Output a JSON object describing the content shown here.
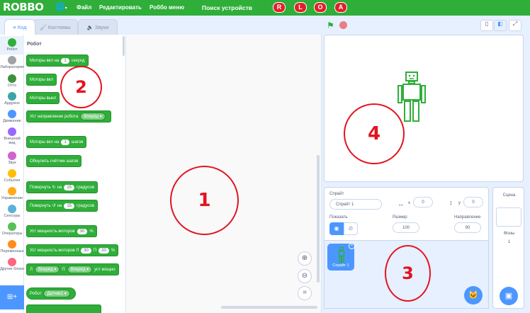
{
  "menubar": {
    "logo": "ROBBO",
    "file": "Файл",
    "edit": "Редактировать",
    "robbo_menu": "Роббо меню",
    "device_search": "Поиск устройств",
    "badges": [
      "R",
      "L",
      "O",
      "A"
    ]
  },
  "tabs": {
    "code": "Код",
    "costumes": "Костюмы",
    "sounds": "Звуки"
  },
  "categories": [
    {
      "label": "Робот",
      "color": "#2fae3a"
    },
    {
      "label": "Лаборатория",
      "color": "#9ea3a8"
    },
    {
      "label": "Отто",
      "color": "#3f8f3f"
    },
    {
      "label": "Ардуино",
      "color": "#3aa5a5"
    },
    {
      "label": "Движение",
      "color": "#4c97ff"
    },
    {
      "label": "Внешний вид",
      "color": "#9966ff"
    },
    {
      "label": "Звук",
      "color": "#cf63cf"
    },
    {
      "label": "События",
      "color": "#ffbf00"
    },
    {
      "label": "Управление",
      "color": "#ffab19"
    },
    {
      "label": "Сенсоры",
      "color": "#5cb1d6"
    },
    {
      "label": "Операторы",
      "color": "#59c059"
    },
    {
      "label": "Переменные",
      "color": "#ff8c1a"
    },
    {
      "label": "Другие блоки",
      "color": "#ff6680"
    }
  ],
  "palette": {
    "title": "Робот",
    "b1": {
      "a": "Моторы вкл на",
      "v": "1",
      "b": "секунд"
    },
    "b2": "Моторы вкл",
    "b3": "Моторы выкл",
    "b4": {
      "a": "Уст направление робота",
      "dd": "Вперёд"
    },
    "b5": {
      "a": "Моторы вкл на",
      "v": "1",
      "b": "шагов"
    },
    "b6": "Обнулить счётчик шагов",
    "b7": {
      "a": "Повернуть",
      "b": "на",
      "v": "15",
      "c": "градусов"
    },
    "b8": {
      "a": "Повернуть",
      "b": "на",
      "v": "15",
      "c": "градусов"
    },
    "b9": {
      "a": "Уст мощность моторов",
      "v": "30",
      "b": "%"
    },
    "b10": {
      "a": "Уст мощность моторов Л",
      "v1": "30",
      "b": "П",
      "v2": "30",
      "c": "%"
    },
    "b11": {
      "a": "Л",
      "dd1": "Вперёд",
      "b": "П",
      "dd2": "Вперёд",
      "c": "уст мощно"
    },
    "b12": {
      "a": "Робот",
      "dd": "Датчик1"
    }
  },
  "annotations": [
    "1",
    "2",
    "3",
    "4"
  ],
  "sprite_info": {
    "sprite_label": "Спрайт",
    "sprite_name": "Спрайт 1",
    "x_label": "x",
    "x_value": "0",
    "y_label": "y",
    "y_value": "0",
    "show_label": "Показать",
    "size_label": "Размер",
    "size_value": "100",
    "direction_label": "Направление",
    "direction_value": "90"
  },
  "sprite_list": {
    "thumb_label": "Спрайт 1"
  },
  "scene": {
    "title": "Сцена",
    "backdrops_label": "Фоны",
    "backdrops_count": "1"
  },
  "colors": {
    "brand": "#2fae3a",
    "accent": "#4c97ff",
    "annotation": "#e3141f"
  }
}
